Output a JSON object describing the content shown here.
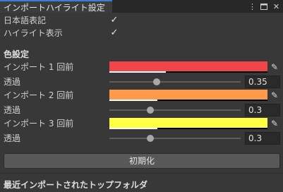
{
  "window": {
    "title": "インポートハイライト設定"
  },
  "toolbar_icons": [
    "more-vert-icon",
    "maximize-icon",
    "close-icon"
  ],
  "options": [
    {
      "label": "日本語表記",
      "checked": true
    },
    {
      "label": "ハイライト表示",
      "checked": true
    }
  ],
  "color_section": {
    "heading": "色設定",
    "items": [
      {
        "label": "インポート 1 回前",
        "color": "#f0464a",
        "alpha_label": "透過",
        "alpha": "0.35"
      },
      {
        "label": "インポート 2 回前",
        "color": "#ff9a4a",
        "alpha_label": "透過",
        "alpha": "0.3"
      },
      {
        "label": "インポート 3 回前",
        "color": "#ffff44",
        "alpha_label": "透過",
        "alpha": "0.3"
      }
    ]
  },
  "reset_button": "初期化",
  "recent_section": {
    "heading": "最近インポートされたトップフォルダ"
  }
}
